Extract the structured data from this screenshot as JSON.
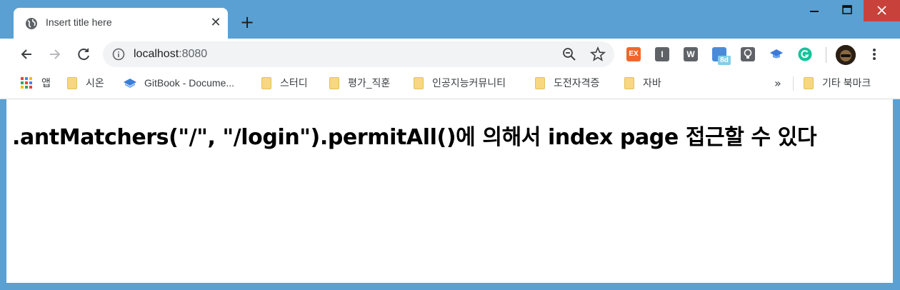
{
  "tab": {
    "title": "Insert title here",
    "close": "✕"
  },
  "newtab": "+",
  "window_controls": {
    "minimize": "—",
    "maximize": "☐",
    "close": "✕"
  },
  "omnibox": {
    "host": "localhost",
    "port": ":8080"
  },
  "extensions": [
    {
      "name": "ex-extension",
      "label": "EX",
      "color": "#f0672b"
    },
    {
      "name": "i-extension",
      "label": "I",
      "color": "#5f6368"
    },
    {
      "name": "w-extension",
      "label": "W",
      "color": "#5f6368"
    },
    {
      "name": "calendar-extension",
      "label": "8d",
      "color": "#4a8bd9"
    },
    {
      "name": "bulb-extension",
      "label": "",
      "color": "#5f6368"
    },
    {
      "name": "cap-extension",
      "label": "",
      "color": "#3c7bd9"
    },
    {
      "name": "grammarly-extension",
      "label": "G",
      "color": "#15c39a"
    }
  ],
  "bookmarks": {
    "apps": "앱",
    "items": [
      "시온",
      "GitBook - Docume...",
      "스터디",
      "평가_직훈",
      "인공지능커뮤니티",
      "도전자격증",
      "자바"
    ],
    "more": "»",
    "other": "기타 북마크"
  },
  "page": {
    "heading": ".antMatchers(\"/\", \"/login\").permitAll()에 의해서 index page 접근할 수 있다"
  }
}
